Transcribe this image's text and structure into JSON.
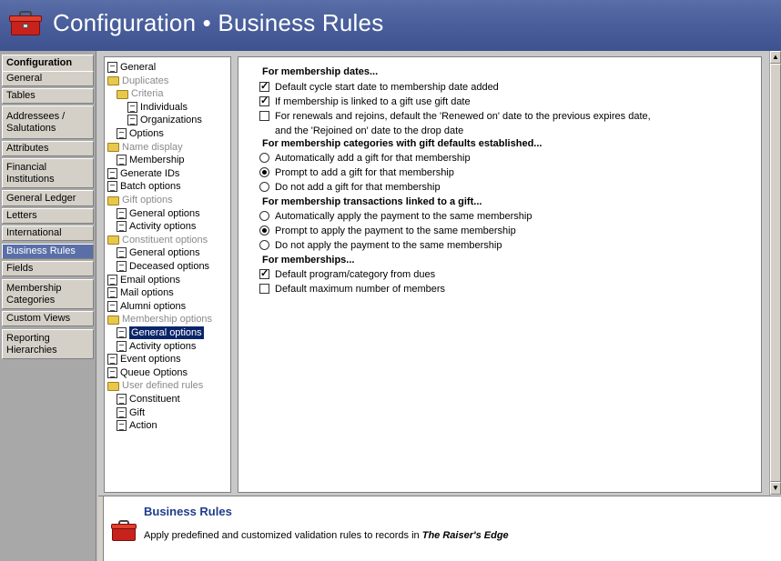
{
  "header": {
    "title": "Configuration • Business Rules",
    "icon": "toolbox-icon"
  },
  "nav": {
    "items": [
      "Configuration",
      "General",
      "Tables",
      "Addressees / Salutations",
      "Attributes",
      "Financial Institutions",
      "General Ledger",
      "Letters",
      "International",
      "Business Rules",
      "Fields",
      "Membership Categories",
      "Custom Views",
      "Reporting Hierarchies"
    ],
    "selected": "Business Rules"
  },
  "tree": {
    "items": [
      {
        "label": "General",
        "type": "doc",
        "state": "normal"
      },
      {
        "label": "Duplicates",
        "type": "folder",
        "state": "disabled"
      },
      {
        "label": "Criteria",
        "type": "folder",
        "state": "disabled"
      },
      {
        "label": "Individuals",
        "type": "doc",
        "state": "normal"
      },
      {
        "label": "Organizations",
        "type": "doc",
        "state": "normal"
      },
      {
        "label": "Options",
        "type": "doc",
        "state": "normal"
      },
      {
        "label": "Name display",
        "type": "folder",
        "state": "disabled"
      },
      {
        "label": "Membership",
        "type": "doc",
        "state": "normal"
      },
      {
        "label": "Generate IDs",
        "type": "doc",
        "state": "normal"
      },
      {
        "label": "Batch options",
        "type": "doc",
        "state": "normal"
      },
      {
        "label": "Gift options",
        "type": "folder",
        "state": "disabled"
      },
      {
        "label": "General options",
        "type": "doc",
        "state": "normal"
      },
      {
        "label": "Activity options",
        "type": "doc",
        "state": "normal"
      },
      {
        "label": "Constituent options",
        "type": "folder",
        "state": "disabled"
      },
      {
        "label": "General options",
        "type": "doc",
        "state": "normal"
      },
      {
        "label": "Deceased options",
        "type": "doc",
        "state": "normal"
      },
      {
        "label": "Email options",
        "type": "doc",
        "state": "normal"
      },
      {
        "label": "Mail options",
        "type": "doc",
        "state": "normal"
      },
      {
        "label": "Alumni options",
        "type": "doc",
        "state": "normal"
      },
      {
        "label": "Membership options",
        "type": "folder",
        "state": "disabled"
      },
      {
        "label": "General options",
        "type": "doc",
        "state": "selected"
      },
      {
        "label": "Activity options",
        "type": "doc",
        "state": "normal"
      },
      {
        "label": "Event options",
        "type": "doc",
        "state": "normal"
      },
      {
        "label": "Queue Options",
        "type": "doc",
        "state": "normal"
      },
      {
        "label": "User defined rules",
        "type": "folder",
        "state": "disabled"
      },
      {
        "label": "Constituent",
        "type": "doc",
        "state": "normal"
      },
      {
        "label": "Gift",
        "type": "doc",
        "state": "normal"
      },
      {
        "label": "Action",
        "type": "doc",
        "state": "normal"
      }
    ]
  },
  "options": {
    "rows": [
      {
        "kind": "head",
        "label": "For membership dates..."
      },
      {
        "kind": "checkbox",
        "checked": true,
        "label": "Default cycle start date to membership date added"
      },
      {
        "kind": "checkbox",
        "checked": true,
        "label": "If membership is linked to a gift use gift date"
      },
      {
        "kind": "checkbox",
        "checked": false,
        "label": "For renewals and rejoins, default the 'Renewed on' date to the previous expires date,",
        "label2": "and the 'Rejoined on' date to the drop date"
      },
      {
        "kind": "head",
        "label": "For membership categories with gift defaults established..."
      },
      {
        "kind": "radio",
        "checked": false,
        "label": "Automatically add a gift for that membership"
      },
      {
        "kind": "radio",
        "checked": true,
        "label": "Prompt to add a gift for that membership"
      },
      {
        "kind": "radio",
        "checked": false,
        "label": "Do not add a gift for that membership"
      },
      {
        "kind": "head",
        "label": "For membership transactions linked to a gift..."
      },
      {
        "kind": "radio",
        "checked": false,
        "label": "Automatically apply the payment to the same membership"
      },
      {
        "kind": "radio",
        "checked": true,
        "label": "Prompt to apply the payment to the same membership"
      },
      {
        "kind": "radio",
        "checked": false,
        "label": "Do not apply the payment to the same membership"
      },
      {
        "kind": "head",
        "label": "For memberships..."
      },
      {
        "kind": "checkbox",
        "checked": true,
        "label": "Default program/category from dues"
      },
      {
        "kind": "checkbox",
        "checked": false,
        "label": "Default maximum number of members"
      }
    ]
  },
  "description": {
    "title": "Business Rules",
    "text_prefix": "Apply predefined and customized validation rules to records in ",
    "text_product": "The Raiser's Edge"
  },
  "colors": {
    "banner": "#4a5f9c",
    "selected_nav": "#5a6fa8",
    "tree_selected": "#0a246a",
    "desc_title": "#1e3c8c"
  }
}
